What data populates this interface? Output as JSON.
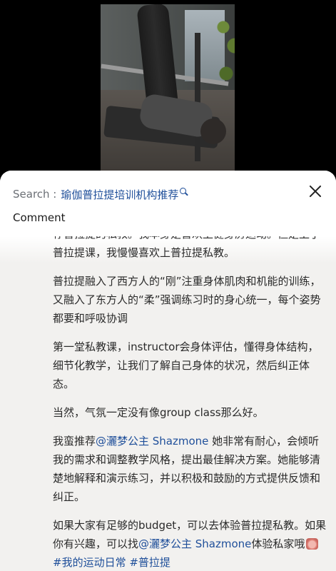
{
  "video": {
    "icon": "pilates-reformer-photo"
  },
  "sheet": {
    "search_prefix": "Search :",
    "search_query": "瑜伽普拉提培训机构推荐",
    "comment_label": "Comment"
  },
  "post": {
    "p1": "荐普拉提的私教。我本身是喜欢上健身房运动。但是上了普拉提课，我慢慢喜欢上普拉提私教。",
    "p2": "普拉提融入了西方人的“刚”注重身体肌肉和机能的训练，又融入了东方人的“柔”强调练习时的身心统一，每个姿势都要和呼吸协调",
    "p3": "第一堂私教课，instructor会身体评估，懂得身体结构，细节化教学，让我们了解自己身体的状况，然后纠正体态。",
    "p4": "当然，气氛一定没有像group class那么好。",
    "p5_before": "我蛮推荐",
    "p5_mention": "@灑梦公主 Shazmone",
    "p5_after": " 她非常有耐心，会倾听我的需求和调整教学风格，提出最佳解决方案。她能够清楚地解释和演示练习，并以积极和鼓励的方式提供反馈和纠正。",
    "p6_before": "如果大家有足够的budget，可以去体验普拉提私教。如果你有兴趣，可以找",
    "p6_mention": "@灑梦公主 Shazmone",
    "p6_mid": "体验私家哦",
    "p6_tag1": "#我的运动日常",
    "p6_tag2": "#普拉提"
  }
}
